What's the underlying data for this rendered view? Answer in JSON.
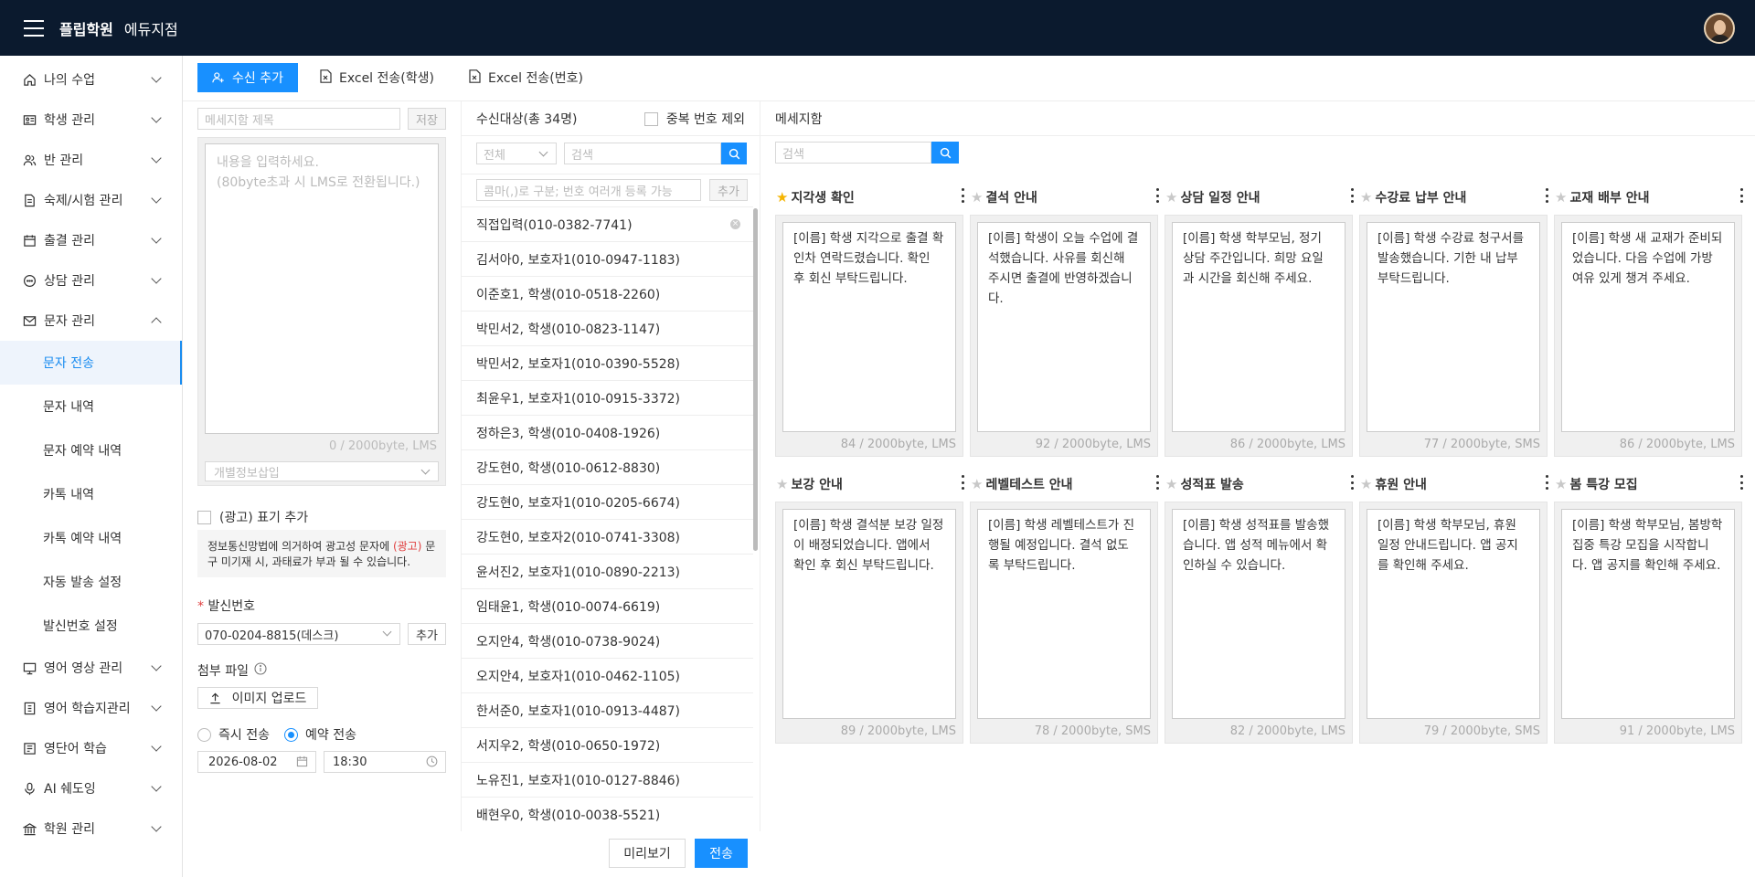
{
  "header": {
    "brand": "플립학원",
    "branch": "에듀지점"
  },
  "sidebar": {
    "items": [
      {
        "label": "나의 수업",
        "icon": "home-icon"
      },
      {
        "label": "학생 관리",
        "icon": "id-card-icon"
      },
      {
        "label": "반 관리",
        "icon": "users-icon"
      },
      {
        "label": "숙제/시험 관리",
        "icon": "document-icon"
      },
      {
        "label": "출결 관리",
        "icon": "calendar-icon"
      },
      {
        "label": "상담 관리",
        "icon": "chat-icon"
      },
      {
        "label": "문자 관리",
        "icon": "mail-icon"
      }
    ],
    "sub_items": [
      "문자 전송",
      "문자 내역",
      "문자 예약 내역",
      "카톡 내역",
      "카톡 예약 내역",
      "자동 발송 설정",
      "발신번호 설정"
    ],
    "items2": [
      {
        "label": "영어 영상 관리",
        "icon": "monitor-icon"
      },
      {
        "label": "영어 학습지관리",
        "icon": "book-icon"
      },
      {
        "label": "영단어 학습",
        "icon": "vocab-icon"
      },
      {
        "label": "AI 쉐도잉",
        "icon": "mic-icon"
      },
      {
        "label": "학원 관리",
        "icon": "bank-icon"
      }
    ]
  },
  "toolbar": {
    "add_recipient": "수신 추가",
    "excel_student": "Excel 전송(학생)",
    "excel_number": "Excel 전송(번호)"
  },
  "compose": {
    "title_placeholder": "메세지함 제목",
    "save": "저장",
    "body_placeholder": "내용을 입력하세요.\n(80byte초과 시 LMS로 전환됩니다.)",
    "byte_count": "0 / 2000byte, LMS",
    "personal_info": "개별정보삽입",
    "ad_label": "(광고) 표기 추가",
    "ad_notice_pre": "정보통신망법에 의거하여 광고성 문자에 ",
    "ad_notice_red": "(광고)",
    "ad_notice_post": " 문구 미기재 시, 과태료가 부과 될 수 있습니다.",
    "sender_label": "발신번호",
    "sender_value": "070-0204-8815(데스크)",
    "sender_add": "추가",
    "attach_label": "첨부 파일",
    "upload": "이미지 업로드",
    "send_now": "즉시 전송",
    "send_reserved": "예약 전송",
    "date": "2026-08-02",
    "time": "18:30"
  },
  "recipients": {
    "title": "수신대상(총 34명)",
    "exclude_dup": "중복 번호 제외",
    "filter": "전체",
    "search_placeholder": "검색",
    "manual_placeholder": "콤마(,)로 구분; 번호 여러개 등록 가능",
    "add": "추가",
    "rows": [
      "직접입력(010-0382-7741)",
      "김서아0, 보호자1(010-0947-1183)",
      "이준호1, 학생(010-0518-2260)",
      "박민서2, 학생(010-0823-1147)",
      "박민서2, 보호자1(010-0390-5528)",
      "최윤우1, 보호자1(010-0915-3372)",
      "정하은3, 학생(010-0408-1926)",
      "강도현0, 학생(010-0612-8830)",
      "강도현0, 보호자1(010-0205-6674)",
      "강도현0, 보호자2(010-0741-3308)",
      "윤서진2, 보호자1(010-0890-2213)",
      "임태윤1, 학생(010-0074-6619)",
      "오지안4, 학생(010-0738-9024)",
      "오지안4, 보호자1(010-0462-1105)",
      "한서준0, 보호자1(010-0913-4487)",
      "서지우2, 학생(010-0650-1972)",
      "노유진1, 보호자1(010-0127-8846)",
      "배현우0, 학생(010-0038-5521)"
    ]
  },
  "templates": {
    "title": "메세지함",
    "search_placeholder": "검색",
    "items": [
      {
        "title": "지각생 확인",
        "starred": true,
        "text": "[이름] 학생 지각으로 출결 확인차 연락드렸습니다. 확인 후 회신 부탁드립니다.",
        "count": "84 / 2000byte, LMS"
      },
      {
        "title": "결석 안내",
        "starred": false,
        "text": "[이름] 학생이 오늘 수업에 결석했습니다. 사유를 회신해 주시면 출결에 반영하겠습니다.",
        "count": "92 / 2000byte, LMS"
      },
      {
        "title": "상담 일정 안내",
        "starred": false,
        "text": "[이름] 학생 학부모님, 정기 상담 주간입니다. 희망 요일과 시간을 회신해 주세요.",
        "count": "86 / 2000byte, LMS"
      },
      {
        "title": "수강료 납부 안내",
        "starred": false,
        "text": "[이름] 학생 수강료 청구서를 발송했습니다. 기한 내 납부 부탁드립니다.",
        "count": "77 / 2000byte, SMS"
      },
      {
        "title": "교재 배부 안내",
        "starred": false,
        "text": "[이름] 학생 새 교재가 준비되었습니다. 다음 수업에 가방 여유 있게 챙겨 주세요.",
        "count": "86 / 2000byte, LMS"
      },
      {
        "title": "보강 안내",
        "starred": false,
        "text": "[이름] 학생 결석분 보강 일정이 배정되었습니다. 앱에서 확인 후 회신 부탁드립니다.",
        "count": "89 / 2000byte, LMS"
      },
      {
        "title": "레벨테스트 안내",
        "starred": false,
        "text": "[이름] 학생 레벨테스트가 진행될 예정입니다. 결석 없도록 부탁드립니다.",
        "count": "78 / 2000byte, SMS"
      },
      {
        "title": "성적표 발송",
        "starred": false,
        "text": "[이름] 학생 성적표를 발송했습니다. 앱 성적 메뉴에서 확인하실 수 있습니다.",
        "count": "82 / 2000byte, LMS"
      },
      {
        "title": "휴원 안내",
        "starred": false,
        "text": "[이름] 학생 학부모님, 휴원 일정 안내드립니다. 앱 공지를 확인해 주세요.",
        "count": "79 / 2000byte, SMS"
      },
      {
        "title": "봄 특강 모집",
        "starred": false,
        "text": "[이름] 학생 학부모님, 봄방학 집중 특강 모집을 시작합니다. 앱 공지를 확인해 주세요.",
        "count": "91 / 2000byte, LMS"
      }
    ]
  },
  "footer": {
    "preview": "미리보기",
    "send": "전송"
  },
  "colors": {
    "primary": "#1890ff",
    "topbar": "#0b1a2e",
    "star": "#f5b400",
    "star_off": "#c8c8c8",
    "ad_red": "#e04040"
  }
}
